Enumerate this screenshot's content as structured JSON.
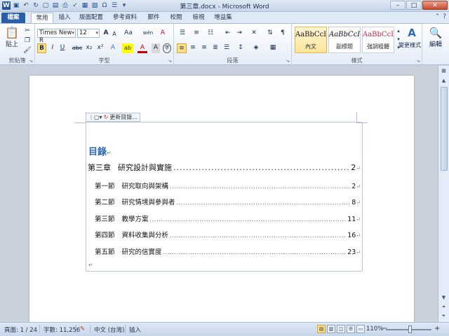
{
  "window": {
    "title": "第三章.docx - Microsoft Word"
  },
  "tabs": [
    {
      "label": "檔案",
      "kind": "file"
    },
    {
      "label": "常用",
      "kind": "active"
    },
    {
      "label": "插入"
    },
    {
      "label": "版面配置"
    },
    {
      "label": "參考資料"
    },
    {
      "label": "郵件"
    },
    {
      "label": "校閱"
    },
    {
      "label": "檢視"
    },
    {
      "label": "增益集"
    }
  ],
  "ribbon": {
    "clipboard": {
      "paste_label": "貼上",
      "group_label": "剪貼簿"
    },
    "font": {
      "family": "Times New R",
      "size": "12",
      "group_label": "字型",
      "grow": "A",
      "shrink": "A",
      "case": "Aa",
      "phonetic": "wén",
      "clear": "A",
      "bold": "B",
      "italic": "I",
      "underline": "U",
      "strike": "abc",
      "subscript": "x₂",
      "superscript": "x²",
      "text_effects": "A",
      "highlight": "ab",
      "font_color": "A",
      "char_shade": "A",
      "enclose": "字"
    },
    "paragraph": {
      "group_label": "段落"
    },
    "styles": {
      "group_label": "樣式",
      "tiles": [
        {
          "sample": "AaBbCcI",
          "name": "內文",
          "selected": true
        },
        {
          "sample": "AaBbCcI",
          "name": "副標題"
        },
        {
          "sample": "AaBbCcI",
          "name": "強調粗體"
        }
      ],
      "change_styles": "變更樣式"
    },
    "editing": {
      "label": "編輯"
    }
  },
  "document": {
    "toc_toolbar_label": "更新目錄...",
    "toc_title": "目錄",
    "entries": [
      {
        "level": 1,
        "label": "第三章",
        "text": "研究設計與實施",
        "page": "2"
      },
      {
        "level": 2,
        "label": "第一節",
        "text": "研究取向與架構",
        "page": "2"
      },
      {
        "level": 2,
        "label": "第二節",
        "text": "研究情境與參與者",
        "page": "8"
      },
      {
        "level": 2,
        "label": "第三節",
        "text": "教學方案",
        "page": "11"
      },
      {
        "level": 2,
        "label": "第四節",
        "text": "資料收集與分析",
        "page": "16"
      },
      {
        "level": 2,
        "label": "第五節",
        "text": "研究的信實度",
        "page": "23"
      }
    ]
  },
  "status": {
    "page": "頁面: 1 / 24",
    "words": "字數: 11,256",
    "language": "中文 (台灣)",
    "mode": "插入",
    "zoom": "110%"
  }
}
